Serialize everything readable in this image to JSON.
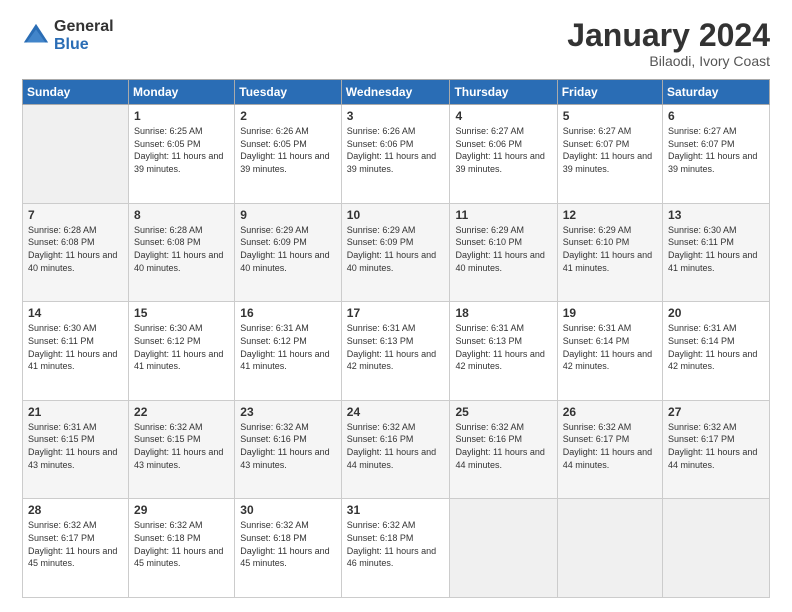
{
  "logo": {
    "general": "General",
    "blue": "Blue"
  },
  "header": {
    "title": "January 2024",
    "subtitle": "Bilaodi, Ivory Coast"
  },
  "weekdays": [
    "Sunday",
    "Monday",
    "Tuesday",
    "Wednesday",
    "Thursday",
    "Friday",
    "Saturday"
  ],
  "weeks": [
    [
      {
        "day": "",
        "info": ""
      },
      {
        "day": "1",
        "info": "Sunrise: 6:25 AM\nSunset: 6:05 PM\nDaylight: 11 hours and 39 minutes."
      },
      {
        "day": "2",
        "info": "Sunrise: 6:26 AM\nSunset: 6:05 PM\nDaylight: 11 hours and 39 minutes."
      },
      {
        "day": "3",
        "info": "Sunrise: 6:26 AM\nSunset: 6:06 PM\nDaylight: 11 hours and 39 minutes."
      },
      {
        "day": "4",
        "info": "Sunrise: 6:27 AM\nSunset: 6:06 PM\nDaylight: 11 hours and 39 minutes."
      },
      {
        "day": "5",
        "info": "Sunrise: 6:27 AM\nSunset: 6:07 PM\nDaylight: 11 hours and 39 minutes."
      },
      {
        "day": "6",
        "info": "Sunrise: 6:27 AM\nSunset: 6:07 PM\nDaylight: 11 hours and 39 minutes."
      }
    ],
    [
      {
        "day": "7",
        "info": "Sunrise: 6:28 AM\nSunset: 6:08 PM\nDaylight: 11 hours and 40 minutes."
      },
      {
        "day": "8",
        "info": "Sunrise: 6:28 AM\nSunset: 6:08 PM\nDaylight: 11 hours and 40 minutes."
      },
      {
        "day": "9",
        "info": "Sunrise: 6:29 AM\nSunset: 6:09 PM\nDaylight: 11 hours and 40 minutes."
      },
      {
        "day": "10",
        "info": "Sunrise: 6:29 AM\nSunset: 6:09 PM\nDaylight: 11 hours and 40 minutes."
      },
      {
        "day": "11",
        "info": "Sunrise: 6:29 AM\nSunset: 6:10 PM\nDaylight: 11 hours and 40 minutes."
      },
      {
        "day": "12",
        "info": "Sunrise: 6:29 AM\nSunset: 6:10 PM\nDaylight: 11 hours and 41 minutes."
      },
      {
        "day": "13",
        "info": "Sunrise: 6:30 AM\nSunset: 6:11 PM\nDaylight: 11 hours and 41 minutes."
      }
    ],
    [
      {
        "day": "14",
        "info": "Sunrise: 6:30 AM\nSunset: 6:11 PM\nDaylight: 11 hours and 41 minutes."
      },
      {
        "day": "15",
        "info": "Sunrise: 6:30 AM\nSunset: 6:12 PM\nDaylight: 11 hours and 41 minutes."
      },
      {
        "day": "16",
        "info": "Sunrise: 6:31 AM\nSunset: 6:12 PM\nDaylight: 11 hours and 41 minutes."
      },
      {
        "day": "17",
        "info": "Sunrise: 6:31 AM\nSunset: 6:13 PM\nDaylight: 11 hours and 42 minutes."
      },
      {
        "day": "18",
        "info": "Sunrise: 6:31 AM\nSunset: 6:13 PM\nDaylight: 11 hours and 42 minutes."
      },
      {
        "day": "19",
        "info": "Sunrise: 6:31 AM\nSunset: 6:14 PM\nDaylight: 11 hours and 42 minutes."
      },
      {
        "day": "20",
        "info": "Sunrise: 6:31 AM\nSunset: 6:14 PM\nDaylight: 11 hours and 42 minutes."
      }
    ],
    [
      {
        "day": "21",
        "info": "Sunrise: 6:31 AM\nSunset: 6:15 PM\nDaylight: 11 hours and 43 minutes."
      },
      {
        "day": "22",
        "info": "Sunrise: 6:32 AM\nSunset: 6:15 PM\nDaylight: 11 hours and 43 minutes."
      },
      {
        "day": "23",
        "info": "Sunrise: 6:32 AM\nSunset: 6:16 PM\nDaylight: 11 hours and 43 minutes."
      },
      {
        "day": "24",
        "info": "Sunrise: 6:32 AM\nSunset: 6:16 PM\nDaylight: 11 hours and 44 minutes."
      },
      {
        "day": "25",
        "info": "Sunrise: 6:32 AM\nSunset: 6:16 PM\nDaylight: 11 hours and 44 minutes."
      },
      {
        "day": "26",
        "info": "Sunrise: 6:32 AM\nSunset: 6:17 PM\nDaylight: 11 hours and 44 minutes."
      },
      {
        "day": "27",
        "info": "Sunrise: 6:32 AM\nSunset: 6:17 PM\nDaylight: 11 hours and 44 minutes."
      }
    ],
    [
      {
        "day": "28",
        "info": "Sunrise: 6:32 AM\nSunset: 6:17 PM\nDaylight: 11 hours and 45 minutes."
      },
      {
        "day": "29",
        "info": "Sunrise: 6:32 AM\nSunset: 6:18 PM\nDaylight: 11 hours and 45 minutes."
      },
      {
        "day": "30",
        "info": "Sunrise: 6:32 AM\nSunset: 6:18 PM\nDaylight: 11 hours and 45 minutes."
      },
      {
        "day": "31",
        "info": "Sunrise: 6:32 AM\nSunset: 6:18 PM\nDaylight: 11 hours and 46 minutes."
      },
      {
        "day": "",
        "info": ""
      },
      {
        "day": "",
        "info": ""
      },
      {
        "day": "",
        "info": ""
      }
    ]
  ]
}
